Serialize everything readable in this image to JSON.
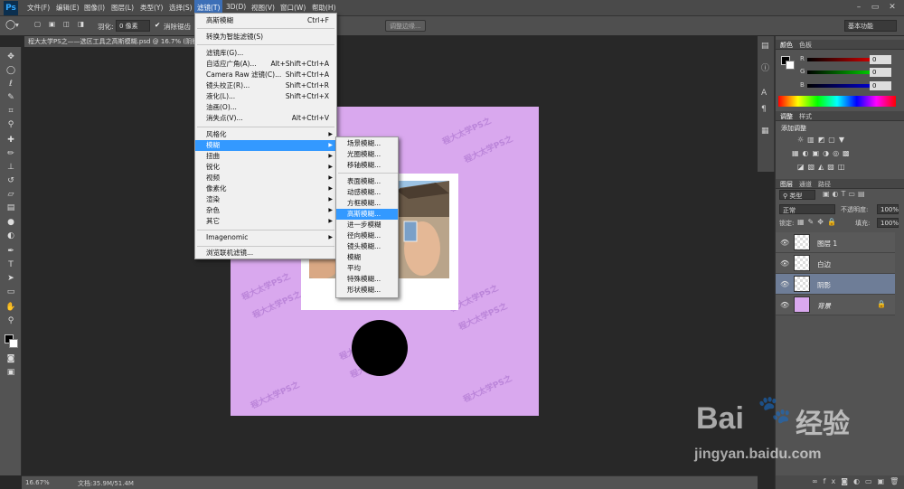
{
  "menubar": {
    "logo": "Ps",
    "items": [
      "文件(F)",
      "编辑(E)",
      "图像(I)",
      "图层(L)",
      "类型(Y)",
      "选择(S)",
      "滤镜(T)",
      "3D(D)",
      "视图(V)",
      "窗口(W)",
      "帮助(H)"
    ],
    "active_index": 6
  },
  "options": {
    "feather_label": "羽化:",
    "feather_value": "0 像素",
    "antialias_label": "消除锯齿",
    "refine_edge": "调整边缘...",
    "workspace": "基本功能"
  },
  "document": {
    "tab_title": "程大太学PS之——选区工具之高斯模糊.psd @ 16.7% (阴影",
    "zoom": "16.67%",
    "doc_size": "文档:35.9M/51.4M"
  },
  "filter_menu": {
    "items": [
      {
        "label": "高斯模糊",
        "shortcut": "Ctrl+F"
      },
      {
        "label": "转换为智能滤镜(S)",
        "shortcut": ""
      },
      {
        "label": "滤镜库(G)...",
        "shortcut": ""
      },
      {
        "label": "自适应广角(A)...",
        "shortcut": "Alt+Shift+Ctrl+A"
      },
      {
        "label": "Camera Raw 滤镜(C)...",
        "shortcut": "Shift+Ctrl+A"
      },
      {
        "label": "镜头校正(R)...",
        "shortcut": "Shift+Ctrl+R"
      },
      {
        "label": "液化(L)...",
        "shortcut": "Shift+Ctrl+X"
      },
      {
        "label": "油画(O)...",
        "shortcut": ""
      },
      {
        "label": "消失点(V)...",
        "shortcut": "Alt+Ctrl+V"
      },
      {
        "label": "风格化",
        "shortcut": ""
      },
      {
        "label": "模糊",
        "shortcut": ""
      },
      {
        "label": "扭曲",
        "shortcut": ""
      },
      {
        "label": "锐化",
        "shortcut": ""
      },
      {
        "label": "视频",
        "shortcut": ""
      },
      {
        "label": "像素化",
        "shortcut": ""
      },
      {
        "label": "渲染",
        "shortcut": ""
      },
      {
        "label": "杂色",
        "shortcut": ""
      },
      {
        "label": "其它",
        "shortcut": ""
      },
      {
        "label": "Imagenomic",
        "shortcut": ""
      },
      {
        "label": "浏览联机滤镜...",
        "shortcut": ""
      }
    ],
    "highlighted": "模糊"
  },
  "blur_submenu": {
    "items": [
      "场景模糊...",
      "光圈模糊...",
      "移轴模糊...",
      "表面模糊...",
      "动感模糊...",
      "方框模糊...",
      "高斯模糊...",
      "进一步模糊",
      "径向模糊...",
      "镜头模糊...",
      "模糊",
      "平均",
      "特殊模糊...",
      "形状模糊..."
    ],
    "highlighted": "高斯模糊..."
  },
  "canvas": {
    "bg_color": "#d9a8ee",
    "watermark_line1": "程大太学PS之",
    "watermark_line2": "程大太学PS之"
  },
  "color_panel": {
    "tabs": [
      "颜色",
      "色板"
    ],
    "r_label": "R",
    "g_label": "G",
    "b_label": "B",
    "r": "0",
    "g": "0",
    "b": "0"
  },
  "adjust_panel": {
    "tabs": [
      "调整",
      "样式"
    ],
    "add_label": "添加调整"
  },
  "layers_panel": {
    "tabs": [
      "图层",
      "通道",
      "路径"
    ],
    "kind": "类型",
    "blend_mode": "正常",
    "opacity_label": "不透明度:",
    "opacity": "100%",
    "lock_label": "锁定:",
    "fill_label": "填充:",
    "fill": "100%",
    "layers": [
      {
        "name": "图层 1",
        "selected": false
      },
      {
        "name": "白边",
        "selected": false
      },
      {
        "name": "阴影",
        "selected": true
      },
      {
        "name": "背景",
        "selected": false
      }
    ]
  },
  "watermark": {
    "brand": "Bai",
    "brand2": "经验",
    "url": "jingyan.baidu.com"
  }
}
